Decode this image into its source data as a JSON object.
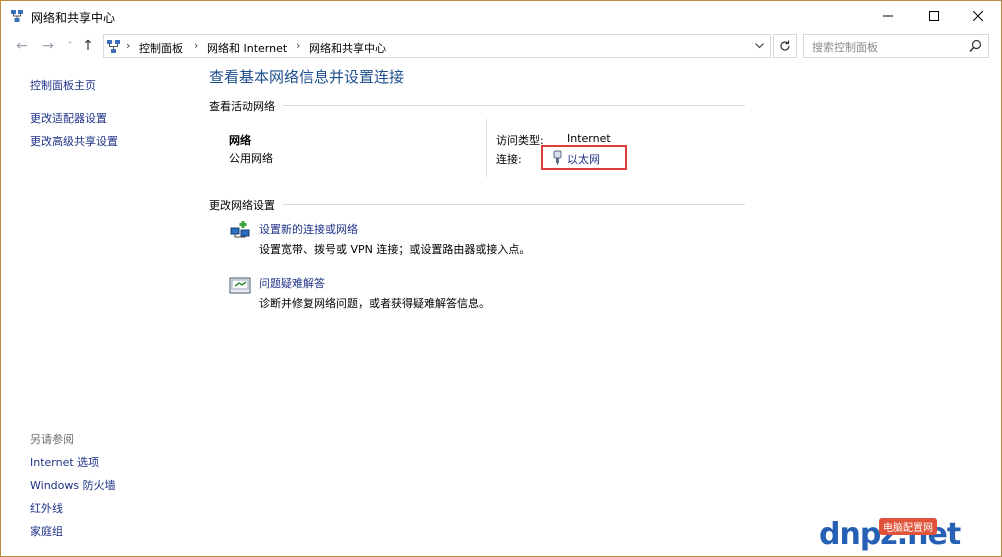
{
  "window": {
    "title": "网络和共享中心",
    "icons": [
      "network-center-icon",
      "minimize-icon",
      "maximize-icon",
      "close-icon"
    ]
  },
  "nav": {
    "back": "←",
    "forward": "→",
    "recent": "˅",
    "up": "↑",
    "breadcrumb": [
      "控制面板",
      "网络和 Internet",
      "网络和共享中心"
    ],
    "separator": "›",
    "search_placeholder": "搜索控制面板"
  },
  "sidebar": {
    "home": "控制面板主页",
    "links": [
      "更改适配器设置",
      "更改高级共享设置"
    ],
    "see_also_title": "另请参阅",
    "see_also": [
      "Internet 选项",
      "Windows 防火墙",
      "红外线",
      "家庭组"
    ]
  },
  "main": {
    "heading": "查看基本网络信息并设置连接",
    "active_section": "查看活动网络",
    "network_name": "网络",
    "network_type": "公用网络",
    "access_type_label": "访问类型:",
    "access_type_value": "Internet",
    "connection_label": "连接:",
    "connection_value": "以太网",
    "change_section": "更改网络设置",
    "tasks": [
      {
        "title": "设置新的连接或网络",
        "desc": "设置宽带、拨号或 VPN 连接；或设置路由器或接入点。",
        "icon": "new-connection-icon"
      },
      {
        "title": "问题疑难解答",
        "desc": "诊断并修复网络问题，或者获得疑难解答信息。",
        "icon": "troubleshoot-icon"
      }
    ]
  },
  "watermark": {
    "logo": "dnpz.net",
    "badge": "电脑配置网"
  },
  "colors": {
    "link": "#1e3287",
    "heading": "#1e4e8c",
    "highlight_box": "#e13b3b",
    "window_border": "#b88a3a"
  }
}
